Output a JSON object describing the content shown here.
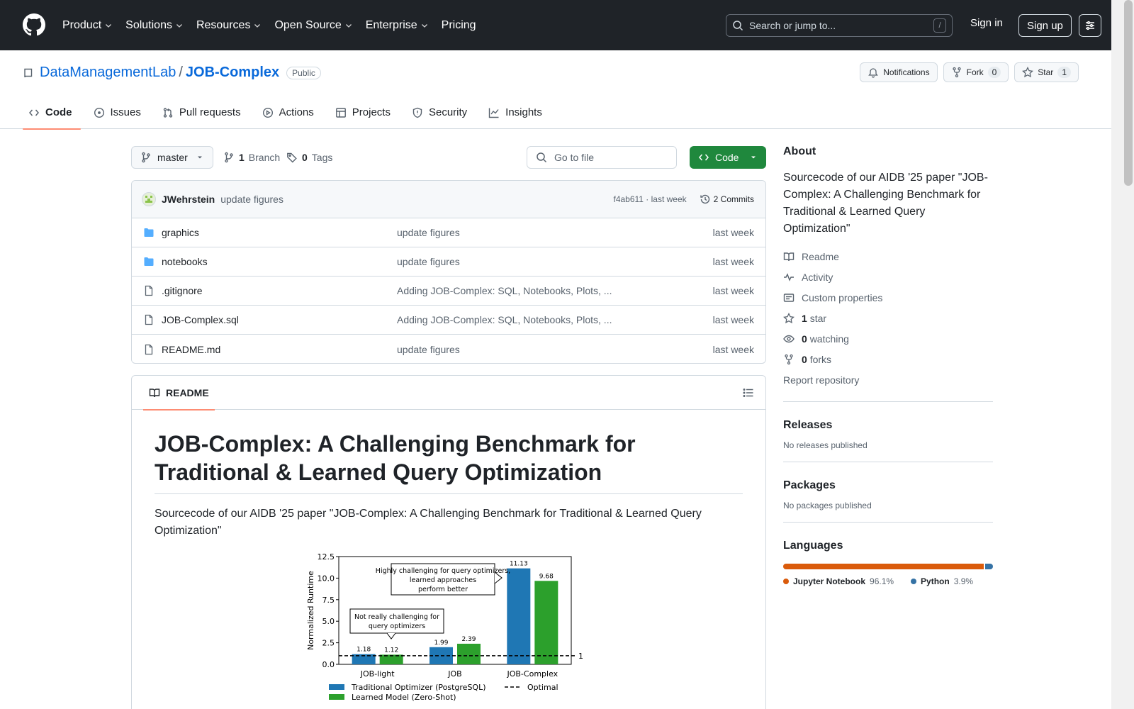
{
  "header": {
    "nav": [
      "Product",
      "Solutions",
      "Resources",
      "Open Source",
      "Enterprise",
      "Pricing"
    ],
    "search_placeholder": "Search or jump to...",
    "search_shortcut": "/",
    "signin": "Sign in",
    "signup": "Sign up"
  },
  "repo": {
    "owner": "DataManagementLab",
    "separator": "/",
    "name": "JOB-Complex",
    "visibility": "Public",
    "notifications_label": "Notifications",
    "fork_label": "Fork",
    "fork_count": "0",
    "star_label": "Star",
    "star_count": "1",
    "tabs": [
      "Code",
      "Issues",
      "Pull requests",
      "Actions",
      "Projects",
      "Security",
      "Insights"
    ]
  },
  "toolbar": {
    "branch": "master",
    "branch_count": "1",
    "branch_label": "Branch",
    "tag_count": "0",
    "tag_label": "Tags",
    "goto_placeholder": "Go to file",
    "code_button": "Code"
  },
  "commit": {
    "author": "JWehrstein",
    "message": "update figures",
    "hash_time": "f4ab611 · last week",
    "commits": "2 Commits"
  },
  "files": [
    {
      "name": "graphics",
      "message": "update figures",
      "time": "last week",
      "type": "folder"
    },
    {
      "name": "notebooks",
      "message": "update figures",
      "time": "last week",
      "type": "folder"
    },
    {
      "name": ".gitignore",
      "message": "Adding JOB-Complex: SQL, Notebooks, Plots, ...",
      "time": "last week",
      "type": "file"
    },
    {
      "name": "JOB-Complex.sql",
      "message": "Adding JOB-Complex: SQL, Notebooks, Plots, ...",
      "time": "last week",
      "type": "file"
    },
    {
      "name": "README.md",
      "message": "update figures",
      "time": "last week",
      "type": "file"
    }
  ],
  "readme": {
    "tab_label": "README",
    "title": "JOB-Complex: A Challenging Benchmark for Traditional & Learned Query Optimization",
    "paragraph": "Sourcecode of our AIDB '25 paper \"JOB-Complex: A Challenging Benchmark for Traditional & Learned Query Optimization\""
  },
  "chart_data": {
    "type": "bar",
    "categories": [
      "JOB-light",
      "JOB",
      "JOB-Complex"
    ],
    "series": [
      {
        "name": "Traditional Optimizer (PostgreSQL)",
        "values": [
          1.18,
          1.99,
          11.13
        ],
        "color": "#1f77b4"
      },
      {
        "name": "Learned Model (Zero-Shot)",
        "values": [
          1.12,
          2.39,
          9.68
        ],
        "color": "#2ca02c"
      }
    ],
    "ylabel": "Normalized Runtime",
    "ylim": [
      0,
      12.5
    ],
    "yticks": [
      "0.0",
      "2.5",
      "5.0",
      "7.5",
      "10.0",
      "12.5"
    ],
    "reference_line": {
      "value": 1,
      "label": "1",
      "legend": "Optimal"
    },
    "annotations": [
      "Highly challenging for query optimizers, learned approaches perform better",
      "Not really challenging for query optimizers"
    ],
    "legend_position": "bottom"
  },
  "sidebar": {
    "about_title": "About",
    "description": "Sourcecode of our AIDB '25 paper \"JOB-Complex: A Challenging Benchmark for Traditional & Learned Query Optimization\"",
    "links": {
      "readme": "Readme",
      "activity": "Activity",
      "custom_properties": "Custom properties",
      "stars_count": "1",
      "stars_label": "star",
      "watching_count": "0",
      "watching_label": "watching",
      "forks_count": "0",
      "forks_label": "forks",
      "report": "Report repository"
    },
    "releases_title": "Releases",
    "releases_text": "No releases published",
    "packages_title": "Packages",
    "packages_text": "No packages published",
    "languages_title": "Languages",
    "languages": [
      {
        "name": "Jupyter Notebook",
        "percent": "96.1%",
        "value": 96.1,
        "color": "#DA5B0B"
      },
      {
        "name": "Python",
        "percent": "3.9%",
        "value": 3.9,
        "color": "#3572A5"
      }
    ]
  }
}
